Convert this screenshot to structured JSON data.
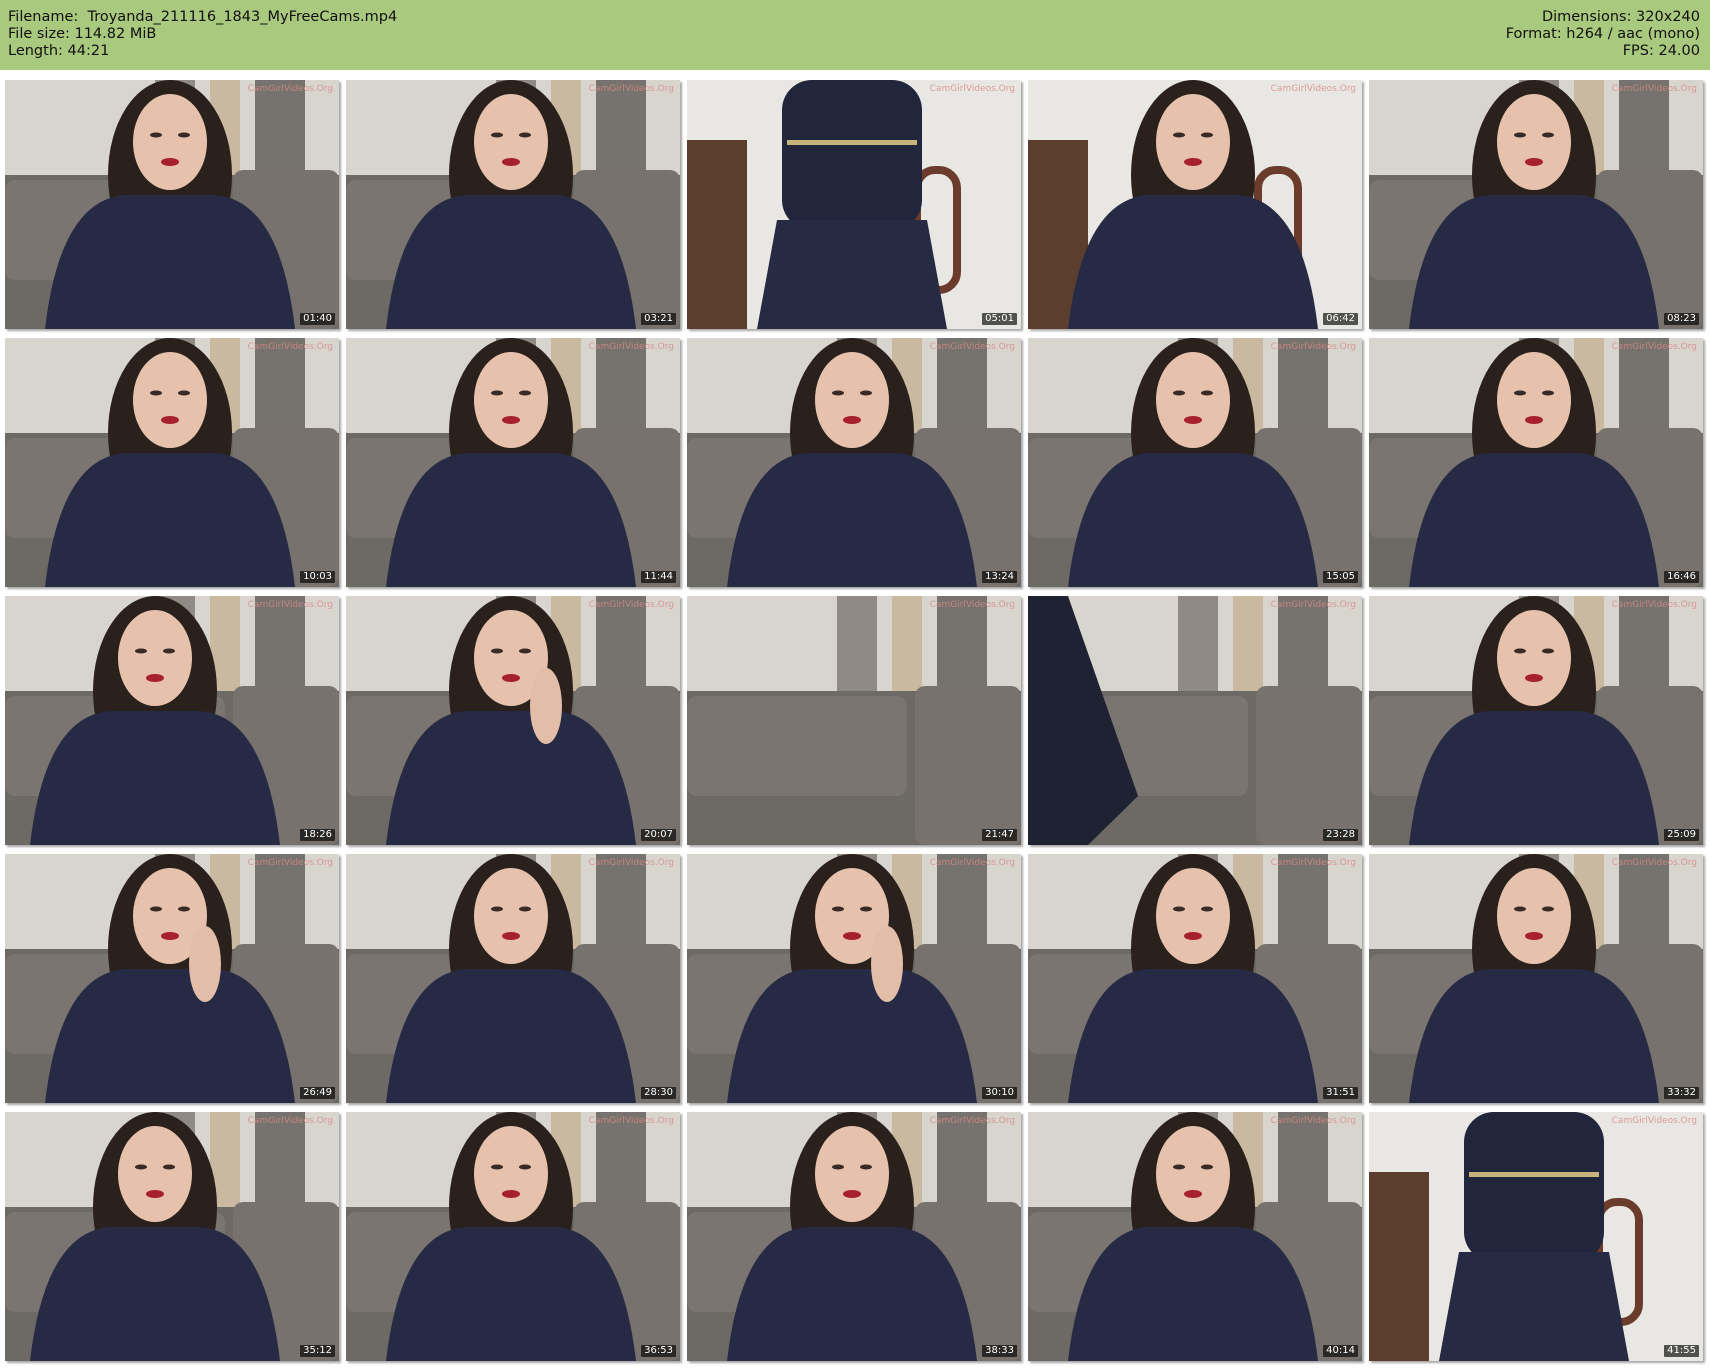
{
  "header": {
    "filename": "Filename:  Troyanda_211116_1843_MyFreeCams.mp4",
    "file_size": "File size: 114.82 MiB",
    "length": "Length: 44:21",
    "dimensions": "Dimensions: 320x240",
    "format": "Format: h264 / aac (mono)",
    "fps": "FPS: 24.00",
    "background": "#a9c97e"
  },
  "watermark": "CamGirlVideos.Org",
  "thumbnails": [
    {
      "time": "01:40",
      "scene": "seated"
    },
    {
      "time": "03:21",
      "scene": "seated"
    },
    {
      "time": "05:01",
      "scene": "standing-room"
    },
    {
      "time": "06:42",
      "scene": "closeup-room"
    },
    {
      "time": "08:23",
      "scene": "seated"
    },
    {
      "time": "10:03",
      "scene": "seated"
    },
    {
      "time": "11:44",
      "scene": "seated"
    },
    {
      "time": "13:24",
      "scene": "seated"
    },
    {
      "time": "15:05",
      "scene": "seated"
    },
    {
      "time": "16:46",
      "scene": "seated"
    },
    {
      "time": "18:26",
      "scene": "seated-side"
    },
    {
      "time": "20:07",
      "scene": "seated-hand"
    },
    {
      "time": "21:47",
      "scene": "empty-sofa"
    },
    {
      "time": "23:28",
      "scene": "blur-sofa"
    },
    {
      "time": "25:09",
      "scene": "seated"
    },
    {
      "time": "26:49",
      "scene": "seated-hand"
    },
    {
      "time": "28:30",
      "scene": "seated"
    },
    {
      "time": "30:10",
      "scene": "seated-hand"
    },
    {
      "time": "31:51",
      "scene": "seated"
    },
    {
      "time": "33:32",
      "scene": "seated"
    },
    {
      "time": "35:12",
      "scene": "seated-side"
    },
    {
      "time": "36:53",
      "scene": "seated"
    },
    {
      "time": "38:33",
      "scene": "seated"
    },
    {
      "time": "40:14",
      "scene": "seated"
    },
    {
      "time": "41:55",
      "scene": "standing-room"
    }
  ]
}
